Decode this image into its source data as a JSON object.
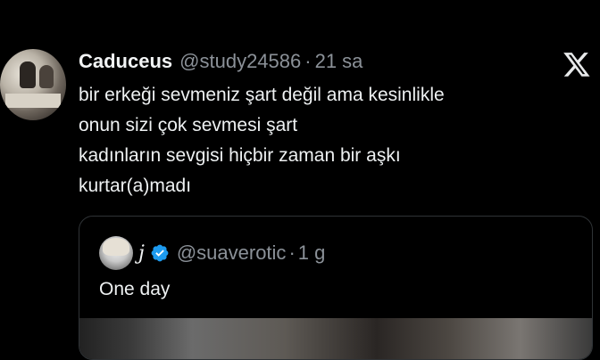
{
  "tweet": {
    "author_name": "Caduceus",
    "handle": "@study24586",
    "separator": "·",
    "time": "21 sa",
    "lines": [
      "bir erkeği sevmeniz şart değil ama kesinlikle",
      "onun sizi çok sevmesi şart",
      "kadınların sevgisi hiçbir zaman bir aşkı",
      "kurtar(a)madı"
    ]
  },
  "quote": {
    "author_name": "j",
    "handle": "@suaverotic",
    "separator": "·",
    "time": "1 g",
    "text": "One day"
  },
  "icons": {
    "platform": "x-logo-icon",
    "verified": "verified-badge-icon"
  },
  "colors": {
    "background": "#000000",
    "text": "#e7e9ea",
    "muted": "#8b9198",
    "verified": "#1d9bf0"
  }
}
